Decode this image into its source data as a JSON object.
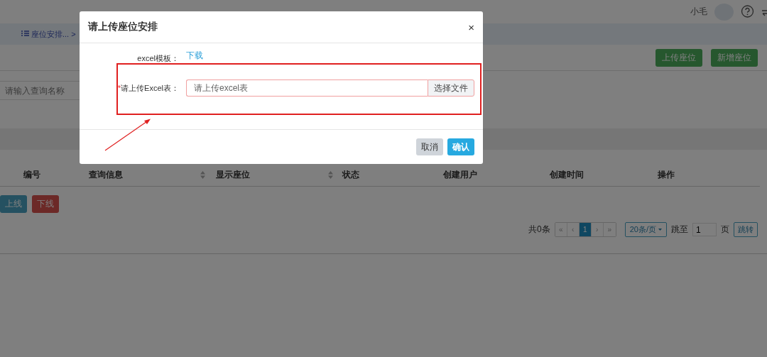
{
  "top_bar": {
    "user_name": "小毛"
  },
  "breadcrumb": {
    "items": [
      {
        "label": "座位安排..."
      }
    ],
    "separator": ">"
  },
  "toolbar": {
    "buttons": [
      "上传座位",
      "新增座位"
    ]
  },
  "search": {
    "placeholder": "请输入查询名称"
  },
  "table": {
    "columns": [
      {
        "label": "编号",
        "sortable": false
      },
      {
        "label": "查询信息",
        "sortable": true
      },
      {
        "label": "显示座位",
        "sortable": true
      },
      {
        "label": "状态",
        "sortable": false
      },
      {
        "label": "创建用户",
        "sortable": false
      },
      {
        "label": "创建时间",
        "sortable": false
      },
      {
        "label": "操作",
        "sortable": false
      }
    ]
  },
  "actions": [
    {
      "label": "上线",
      "kind": "online"
    },
    {
      "label": "下线",
      "kind": "offline"
    }
  ],
  "pagination": {
    "total": "共0条",
    "first": "«",
    "prev": "‹",
    "pages": [
      {
        "label": "1",
        "selected": true
      }
    ],
    "next": "›",
    "last": "»",
    "page_size": "20条/页",
    "jump_label": "跳至",
    "jump_value": "1",
    "page_unit": "页",
    "jump_button": "跳转"
  },
  "dialog": {
    "title": "请上传座位安排",
    "close": "×",
    "template_label": "excel模板：",
    "template_link": "下载",
    "required": true,
    "required_mark": "*",
    "upload_label": "请上传Excel表：",
    "upload_placeholder": "请上传excel表",
    "choose_button": "选择文件",
    "buttons": [
      {
        "label": "取消",
        "kind": "cancel"
      },
      {
        "label": "确认",
        "kind": "primary"
      }
    ]
  }
}
